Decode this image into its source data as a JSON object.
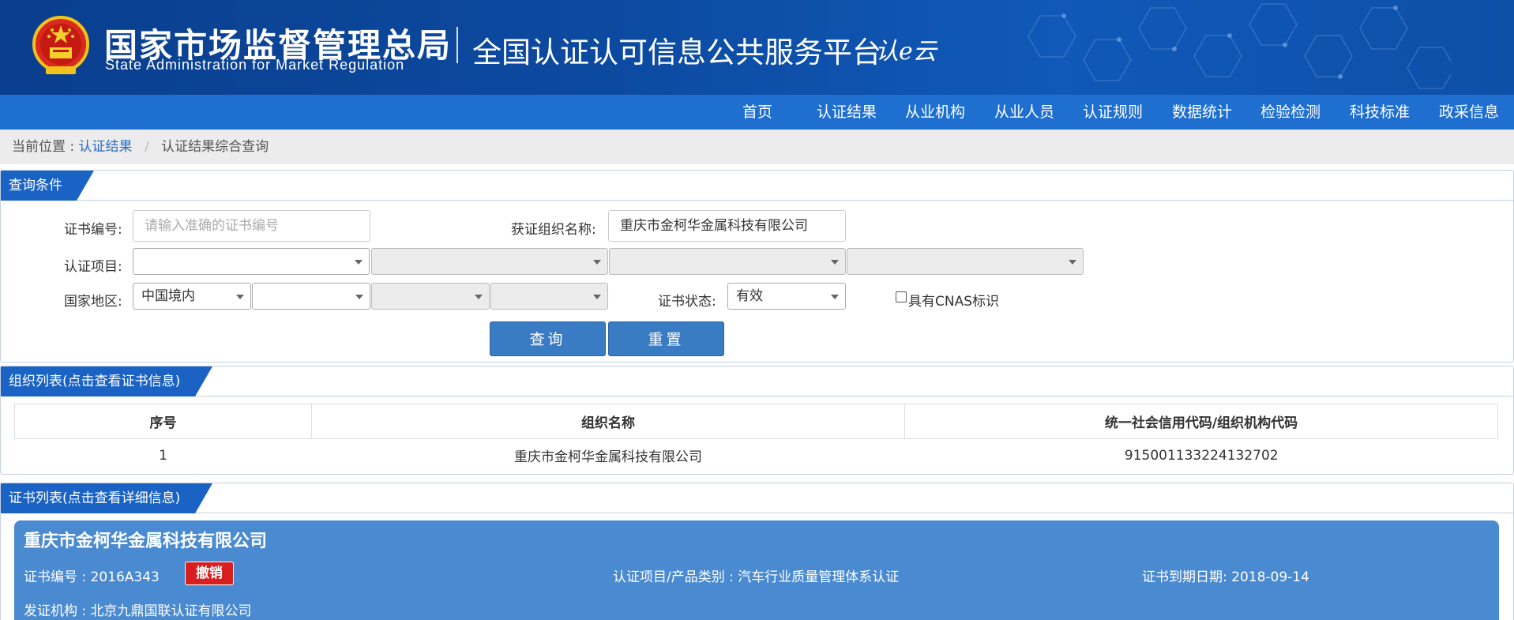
{
  "header": {
    "title_cn": "国家市场监督管理总局",
    "title_en": "State Administration  for  Market Regulation",
    "platform": "全国认证认可信息公共服务平台",
    "logo_mark": "认e云"
  },
  "nav": {
    "items": [
      "首页",
      "认证结果",
      "从业机构",
      "从业人员",
      "认证规则",
      "数据统计",
      "检验检测",
      "科技标准",
      "政采信息"
    ]
  },
  "breadcrumb": {
    "prefix": "当前位置 :",
    "link": "认证结果",
    "separator": "/",
    "current": "认证结果综合查询"
  },
  "query": {
    "section_title": "查询条件",
    "cert_no_label": "证书编号:",
    "cert_no_placeholder": "请输入准确的证书编号",
    "org_name_label": "获证组织名称:",
    "org_name_value": "重庆市金柯华金属科技有限公司",
    "project_label": "认证项目:",
    "region_label": "国家地区:",
    "region_value": "中国境内",
    "status_label": "证书状态:",
    "status_value": "有效",
    "cnas_label": "具有CNAS标识",
    "search_button": "查询",
    "reset_button": "重置"
  },
  "org_list": {
    "section_title": "组织列表(点击查看证书信息)",
    "columns": [
      "序号",
      "组织名称",
      "统一社会信用代码/组织机构代码"
    ],
    "rows": [
      [
        "1",
        "重庆市金柯华金属科技有限公司",
        "915001133224132702"
      ]
    ]
  },
  "cert_list": {
    "section_title": "证书列表(点击查看详细信息)",
    "card": {
      "org_name": "重庆市金柯华金属科技有限公司",
      "cert_no": "证书编号 : 2016A343",
      "status_badge": "撤销",
      "project": "认证项目/产品类别 : 汽车行业质量管理体系认证",
      "expiry": "证书到期日期: 2018-09-14",
      "issuer": "发证机构 : 北京九鼎国联认证有限公司"
    }
  },
  "colors": {
    "header_bg": "#0c4aa0",
    "nav_bg": "#1e6fd0",
    "tag_bg": "#1a63c4",
    "button_bg": "#3a7cc4",
    "card_bg": "#4a8ad0",
    "badge_bg": "#d81e1e"
  }
}
